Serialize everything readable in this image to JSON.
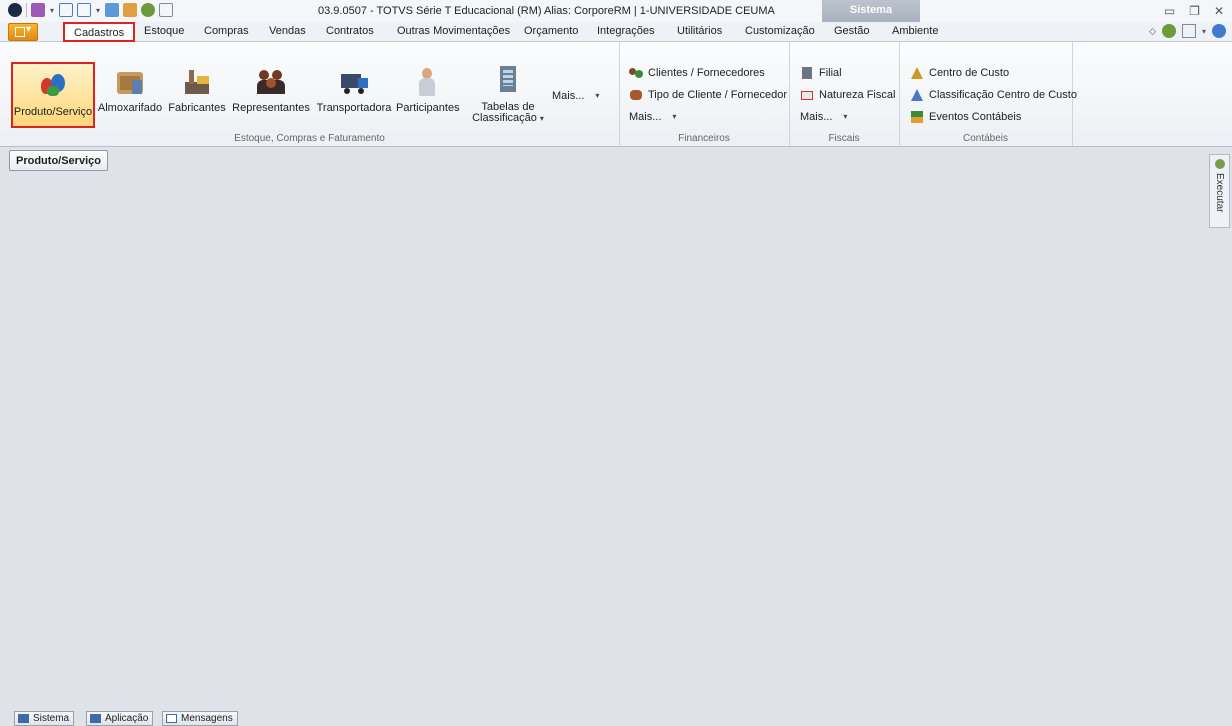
{
  "window": {
    "title": "03.9.0507 - TOTVS Série T Educacional (RM) Alias: CorporeRM | 1-UNIVERSIDADE CEUMA",
    "context_tab": "Sistema",
    "controls": [
      "minimize-icon",
      "restore-icon",
      "close-icon"
    ]
  },
  "tabs": [
    "Cadastros",
    "Estoque",
    "Compras",
    "Vendas",
    "Contratos",
    "Outras Movimentações",
    "Orçamento",
    "Integrações",
    "Utilitários",
    "Customização",
    "Gestão",
    "Ambiente"
  ],
  "active_tab": "Cadastros",
  "ribbon": {
    "group1": {
      "label": "Estoque, Compras e Faturamento",
      "buttons": [
        "Produto/Serviço",
        "Almoxarifado",
        "Fabricantes",
        "Representantes",
        "Transportadora",
        "Participantes"
      ],
      "tabelas_line1": "Tabelas de",
      "tabelas_line2": "Classificação",
      "mais": "Mais..."
    },
    "financeiros": {
      "label": "Financeiros",
      "items": [
        "Clientes / Fornecedores",
        "Tipo de Cliente / Fornecedor"
      ],
      "mais": "Mais..."
    },
    "fiscais": {
      "label": "Fiscais",
      "items": [
        "Filial",
        "Natureza Fiscal"
      ],
      "mais": "Mais..."
    },
    "contabeis": {
      "label": "Contábeis",
      "items": [
        "Centro de Custo",
        "Classificação Centro de Custo",
        "Eventos Contábeis"
      ]
    }
  },
  "content": {
    "open_tab": "Produto/Serviço",
    "side_panel": "Executar"
  },
  "bottom": {
    "tabs": [
      "Sistema",
      "Aplicação",
      "Mensagens"
    ]
  },
  "colors": {
    "highlight_border": "#dd2222",
    "selected_fill": "#ffd77a",
    "app_menu": "#f0a020"
  }
}
